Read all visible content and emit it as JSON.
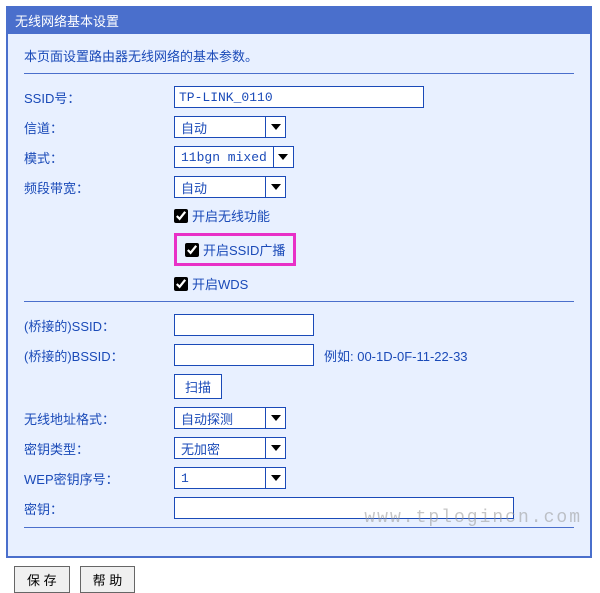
{
  "header": {
    "title": "无线网络基本设置"
  },
  "description": "本页面设置路由器无线网络的基本参数。",
  "fields": {
    "ssid": {
      "label": "SSID号：",
      "value": "TP-LINK_0110"
    },
    "channel": {
      "label": "信道：",
      "value": "自动"
    },
    "mode": {
      "label": "模式：",
      "value": "11bgn mixed"
    },
    "bandwidth": {
      "label": "频段带宽：",
      "value": "自动"
    },
    "enable_wireless": {
      "label": "开启无线功能"
    },
    "enable_ssid_broadcast": {
      "label": "开启SSID广播"
    },
    "enable_wds": {
      "label": "开启WDS"
    },
    "bridge_ssid": {
      "label": "(桥接的)SSID：",
      "value": ""
    },
    "bridge_bssid": {
      "label": "(桥接的)BSSID：",
      "value": "",
      "example": "例如: 00-1D-0F-11-22-33"
    },
    "scan": {
      "label": "扫描"
    },
    "addr_format": {
      "label": "无线地址格式：",
      "value": "自动探测"
    },
    "key_type": {
      "label": "密钥类型：",
      "value": "无加密"
    },
    "wep_index": {
      "label": "WEP密钥序号：",
      "value": "1"
    },
    "key": {
      "label": "密钥：",
      "value": ""
    }
  },
  "buttons": {
    "save": "保 存",
    "help": "帮 助"
  },
  "watermark": "www.tplogincn.com"
}
